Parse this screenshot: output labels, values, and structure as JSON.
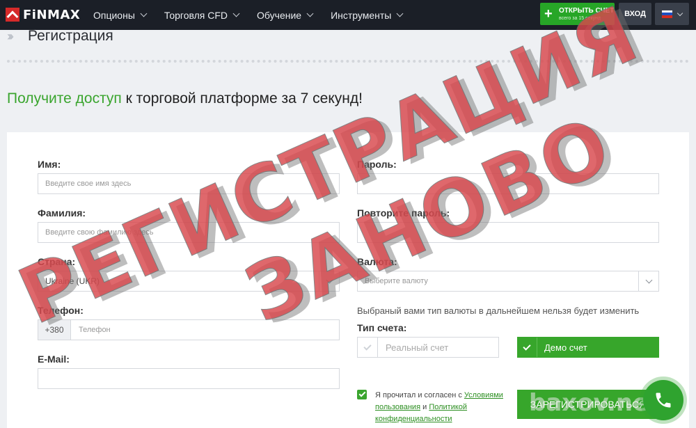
{
  "header": {
    "brand": "FiNMAX",
    "nav": [
      {
        "label": "Опционы"
      },
      {
        "label": "Торговля CFD"
      },
      {
        "label": "Обучение"
      },
      {
        "label": "Инструменты"
      }
    ],
    "open_account": {
      "label": "ОТКРЫТЬ СЧЕТ",
      "sub": "всего за 15 секунд"
    },
    "login": "ВХОД",
    "language_flag": "russian-flag-icon",
    "flag_colors": [
      "#ffffff",
      "#1f4fbf",
      "#d52b1e"
    ]
  },
  "page": {
    "title": "Регистрация",
    "headline_highlight": "Получите доступ",
    "headline_rest": " к торговой платформе за 7 секунд!"
  },
  "form": {
    "first_name": {
      "label": "Имя:",
      "placeholder": "Введите свое имя здесь"
    },
    "last_name": {
      "label": "Фамилия:",
      "placeholder": "Введите свою фамилию здесь"
    },
    "country": {
      "label": "Страна:",
      "value": "Ukraine (UKR)"
    },
    "phone": {
      "label": "Телефон:",
      "prefix": "+380",
      "placeholder": "Телефон"
    },
    "email": {
      "label": "E-Mail:",
      "placeholder": ""
    },
    "password": {
      "label": "Пароль:",
      "placeholder": ""
    },
    "password_repeat": {
      "label": "Повторите пароль:",
      "placeholder": ""
    },
    "currency": {
      "label": "Валюта:",
      "placeholder": "Выберите валюту"
    },
    "currency_hint": "Выбраный вами тип валюты в дальнейшем нельзя будет изменить",
    "account_type": {
      "label": "Тип счета:",
      "real": "Реальный счет",
      "demo": "Демо счет",
      "selected": "demo"
    },
    "agreement": {
      "prefix": "Я прочитал и согласен с ",
      "terms_link": "Условиями пользования",
      "middle": " и ",
      "privacy_link": "Политикой конфиденциальности",
      "checked": true
    },
    "submit": "ЗАРЕГИСТРИРОВАТЬСЯ"
  },
  "overlay": {
    "stamp_line1": "РЕГИСТРАЦИЯ",
    "stamp_line2": "ЗАНОВО",
    "watermark": "baxov.net",
    "stamp_color": "#d9474c"
  },
  "colors": {
    "accent_green": "#3aa52e",
    "header_bg": "#1b1f27"
  }
}
